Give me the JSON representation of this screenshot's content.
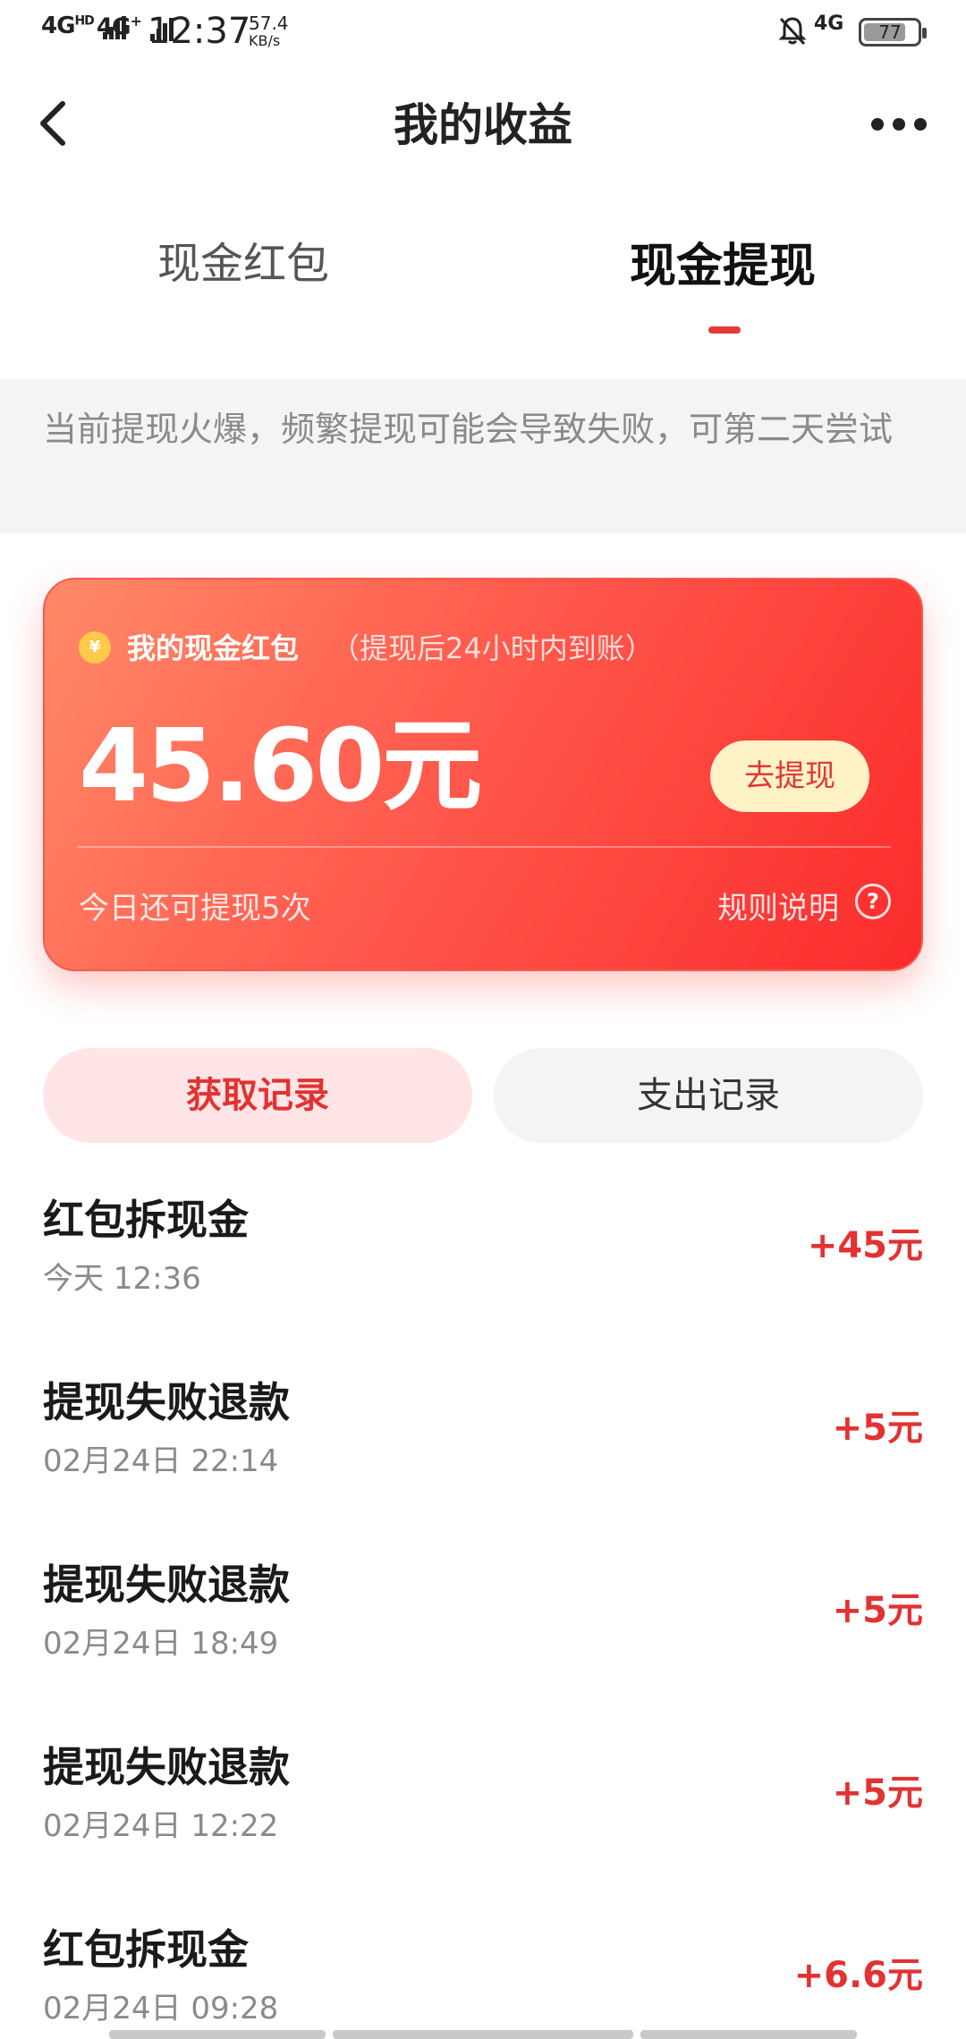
{
  "status_bar": {
    "network_left_1": "4G",
    "network_left_1_sup": "HD",
    "network_left_2": "4G",
    "network_left_2_sup": "+",
    "time": "12:37",
    "speed_value": "57.4",
    "speed_unit": "KB/s",
    "network_right": "4G",
    "battery": "77"
  },
  "header": {
    "title": "我的收益"
  },
  "tabs": [
    {
      "label": "现金红包",
      "active": false
    },
    {
      "label": "现金提现",
      "active": true
    }
  ],
  "notice": "当前提现火爆，频繁提现可能会导致失败，可第二天尝试",
  "card": {
    "title": "我的现金红包",
    "subtitle": "（提现后24小时内到账）",
    "coin_symbol": "¥",
    "amount": "45.60元",
    "withdraw_button": "去提现",
    "remaining": "今日还可提现5次",
    "rules": "规则说明",
    "help_symbol": "?"
  },
  "segments": {
    "income": "获取记录",
    "expense": "支出记录"
  },
  "records": [
    {
      "title": "红包拆现金",
      "time": "今天 12:36",
      "amount": "+45元"
    },
    {
      "title": "提现失败退款",
      "time": "02月24日 22:14",
      "amount": "+5元"
    },
    {
      "title": "提现失败退款",
      "time": "02月24日 18:49",
      "amount": "+5元"
    },
    {
      "title": "提现失败退款",
      "time": "02月24日 12:22",
      "amount": "+5元"
    },
    {
      "title": "红包拆现金",
      "time": "02月24日 09:28",
      "amount": "+6.6元"
    }
  ],
  "colors": {
    "accent_red": "#e23232",
    "card_gradient_start": "#ff8a68",
    "card_gradient_end": "#fb2b2c",
    "button_cream": "#fff2c6"
  }
}
